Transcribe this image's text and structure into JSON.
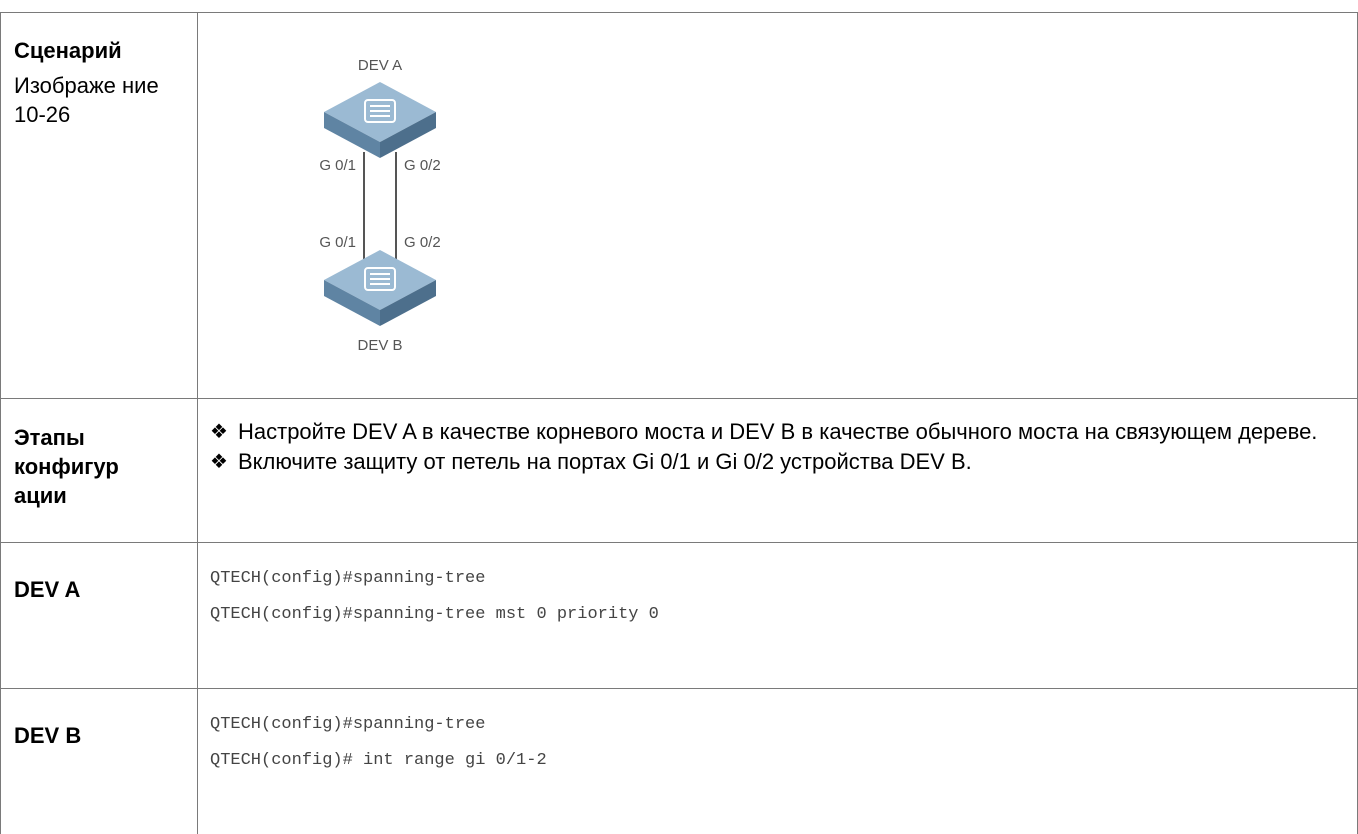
{
  "rows": {
    "scenario": {
      "label": "Сценарий",
      "caption": "Изображе ние 10-26",
      "diagram": {
        "dev_a": "DEV A",
        "dev_b": "DEV B",
        "a_left_port": "G 0/1",
        "a_right_port": "G 0/2",
        "b_left_port": "G 0/1",
        "b_right_port": "G 0/2"
      }
    },
    "steps": {
      "label": "Этапы конфигур ации",
      "items": [
        "Настройте DEV A в качестве корневого моста и DEV B в качестве обычного моста на связующем дереве.",
        "Включите защиту от петель на портах Gi 0/1 и Gi 0/2 устройства DEV B."
      ]
    },
    "dev_a": {
      "label": "DEV A",
      "code": [
        "QTECH(config)#spanning-tree",
        "QTECH(config)#spanning-tree mst 0 priority 0"
      ]
    },
    "dev_b": {
      "label": "DEV B",
      "code": [
        "QTECH(config)#spanning-tree",
        "QTECH(config)# int range gi 0/1-2"
      ]
    }
  },
  "colors": {
    "border": "#7a7a7a",
    "switch_top": "#8fb0cc",
    "switch_side": "#5b7f9e",
    "code_text": "#444444"
  },
  "icons": {
    "bullet": "❖",
    "switch": "network-switch-icon"
  }
}
